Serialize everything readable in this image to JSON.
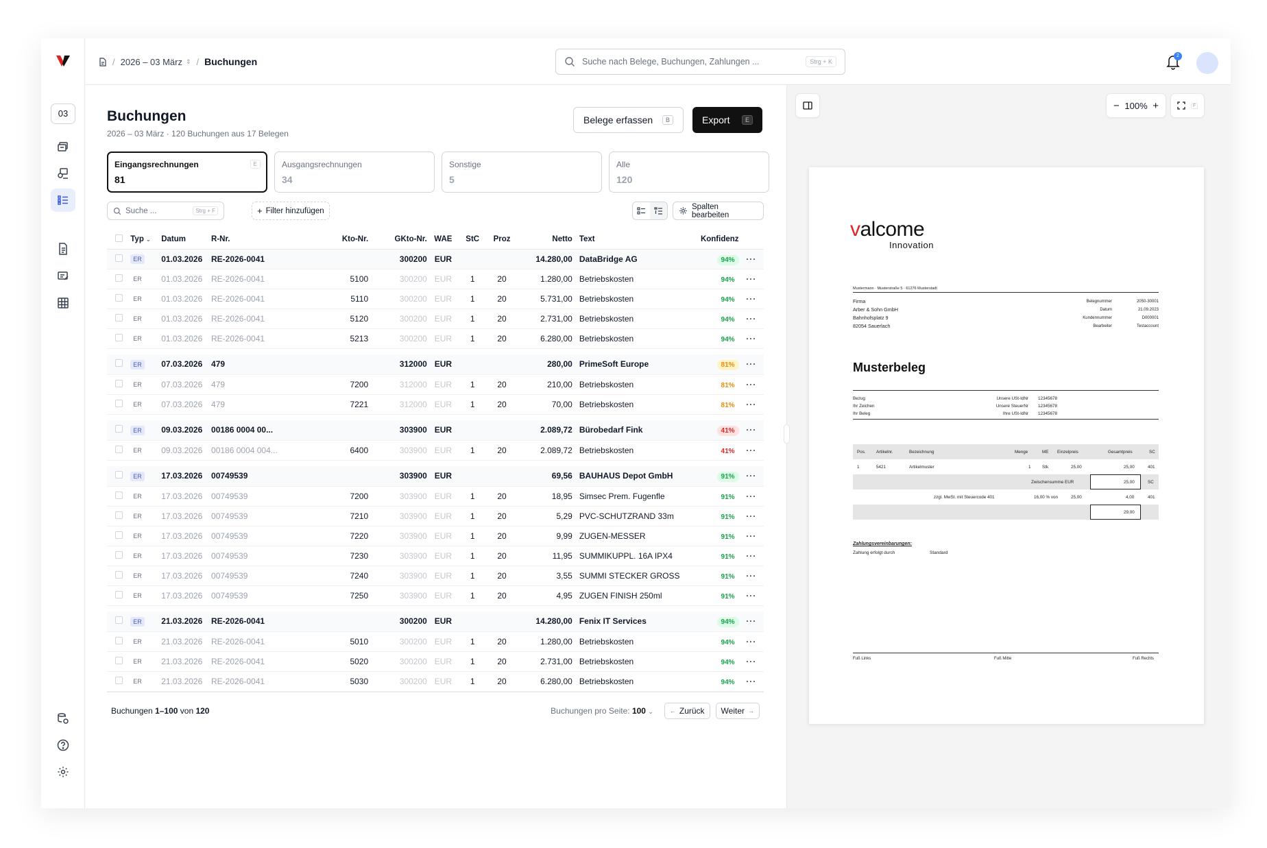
{
  "app": {
    "badge": "03"
  },
  "breadcrumb": {
    "year": "2026 – 03 März",
    "current": "Buchungen"
  },
  "search": {
    "placeholder": "Suche nach Belege, Buchungen, Zahlungen ...",
    "shortcut": "Strg + K"
  },
  "notifications": {
    "count": "2"
  },
  "page": {
    "title": "Buchungen",
    "subtitle": "2026 – 03 März · 120 Buchungen aus 17 Belegen",
    "capture_label": "Belege erfassen",
    "capture_key": "B",
    "export_label": "Export",
    "export_key": "E"
  },
  "tabs": [
    {
      "label": "Eingangsrechnungen",
      "count": "81",
      "key": "E"
    },
    {
      "label": "Ausgangsrechnungen",
      "count": "34"
    },
    {
      "label": "Sonstige",
      "count": "5"
    },
    {
      "label": "Alle",
      "count": "120"
    }
  ],
  "toolbar": {
    "search_placeholder": "Suche ...",
    "search_key": "Strg + F",
    "filter_label": "Filter hinzufügen",
    "columns_label": "Spalten bearbeiten"
  },
  "columns": {
    "typ": "Typ",
    "datum": "Datum",
    "rnr": "R-Nr.",
    "kto": "Kto-Nr.",
    "gkto": "GKto-Nr.",
    "wae": "WAE",
    "stc": "StC",
    "proz": "Proz",
    "netto": "Netto",
    "text": "Text",
    "konfidenz": "Konfidenz"
  },
  "rows": [
    {
      "g": 1,
      "typ": "ER",
      "datum": "01.03.2026",
      "rnr": "RE-2026-0041",
      "kto": "",
      "gkto": "300200",
      "wae": "EUR",
      "stc": "",
      "proz": "",
      "netto": "14.280,00",
      "text": "DataBridge AG",
      "konf": "94%",
      "c": "g"
    },
    {
      "typ": "ER",
      "datum": "01.03.2026",
      "rnr": "RE-2026-0041",
      "kto": "5100",
      "gkto": "300200",
      "wae": "EUR",
      "stc": "1",
      "proz": "20",
      "netto": "1.280,00",
      "text": "Betriebskosten",
      "konf": "94%",
      "c": "g"
    },
    {
      "typ": "ER",
      "datum": "01.03.2026",
      "rnr": "RE-2026-0041",
      "kto": "5110",
      "gkto": "300200",
      "wae": "EUR",
      "stc": "1",
      "proz": "20",
      "netto": "5.731,00",
      "text": "Betriebskosten",
      "konf": "94%",
      "c": "g"
    },
    {
      "typ": "ER",
      "datum": "01.03.2026",
      "rnr": "RE-2026-0041",
      "kto": "5120",
      "gkto": "300200",
      "wae": "EUR",
      "stc": "1",
      "proz": "20",
      "netto": "2.731,00",
      "text": "Betriebskosten",
      "konf": "94%",
      "c": "g"
    },
    {
      "typ": "ER",
      "datum": "01.03.2026",
      "rnr": "RE-2026-0041",
      "kto": "5213",
      "gkto": "300200",
      "wae": "EUR",
      "stc": "1",
      "proz": "20",
      "netto": "6.280,00",
      "text": "Betriebskosten",
      "konf": "94%",
      "c": "g"
    },
    {
      "g": 1,
      "typ": "ER",
      "datum": "07.03.2026",
      "rnr": "479",
      "kto": "",
      "gkto": "312000",
      "wae": "EUR",
      "stc": "",
      "proz": "",
      "netto": "280,00",
      "text": "PrimeSoft Europe",
      "konf": "81%",
      "c": "o"
    },
    {
      "typ": "ER",
      "datum": "07.03.2026",
      "rnr": "479",
      "kto": "7200",
      "gkto": "312000",
      "wae": "EUR",
      "stc": "1",
      "proz": "20",
      "netto": "210,00",
      "text": "Betriebskosten",
      "konf": "81%",
      "c": "o"
    },
    {
      "typ": "ER",
      "datum": "07.03.2026",
      "rnr": "479",
      "kto": "7221",
      "gkto": "312000",
      "wae": "EUR",
      "stc": "1",
      "proz": "20",
      "netto": "70,00",
      "text": "Betriebskosten",
      "konf": "81%",
      "c": "o"
    },
    {
      "g": 1,
      "typ": "ER",
      "datum": "09.03.2026",
      "rnr": "00186 0004 00...",
      "kto": "",
      "gkto": "303900",
      "wae": "EUR",
      "stc": "",
      "proz": "",
      "netto": "2.089,72",
      "text": "Bürobedarf Fink",
      "konf": "41%",
      "c": "rd"
    },
    {
      "typ": "ER",
      "datum": "09.03.2026",
      "rnr": "00186 0004 004...",
      "kto": "6400",
      "gkto": "303900",
      "wae": "EUR",
      "stc": "1",
      "proz": "20",
      "netto": "2.089,72",
      "text": "Betriebskosten",
      "konf": "41%",
      "c": "rd"
    },
    {
      "g": 1,
      "typ": "ER",
      "datum": "17.03.2026",
      "rnr": "00749539",
      "kto": "",
      "gkto": "303900",
      "wae": "EUR",
      "stc": "",
      "proz": "",
      "netto": "69,56",
      "text": "BAUHAUS Depot GmbH",
      "konf": "91%",
      "c": "g"
    },
    {
      "typ": "ER",
      "datum": "17.03.2026",
      "rnr": "00749539",
      "kto": "7200",
      "gkto": "303900",
      "wae": "EUR",
      "stc": "1",
      "proz": "20",
      "netto": "18,95",
      "text": "Simsec Prem. Fugenfle",
      "konf": "91%",
      "c": "g"
    },
    {
      "typ": "ER",
      "datum": "17.03.2026",
      "rnr": "00749539",
      "kto": "7210",
      "gkto": "303900",
      "wae": "EUR",
      "stc": "1",
      "proz": "20",
      "netto": "5,29",
      "text": "PVC-SCHUTZRAND 33m",
      "konf": "91%",
      "c": "g"
    },
    {
      "typ": "ER",
      "datum": "17.03.2026",
      "rnr": "00749539",
      "kto": "7220",
      "gkto": "303900",
      "wae": "EUR",
      "stc": "1",
      "proz": "20",
      "netto": "9,99",
      "text": "ZUGEN-MESSER",
      "konf": "91%",
      "c": "g"
    },
    {
      "typ": "ER",
      "datum": "17.03.2026",
      "rnr": "00749539",
      "kto": "7230",
      "gkto": "303900",
      "wae": "EUR",
      "stc": "1",
      "proz": "20",
      "netto": "11,95",
      "text": "SUMMIKUPPL. 16A IPX4",
      "konf": "91%",
      "c": "g"
    },
    {
      "typ": "ER",
      "datum": "17.03.2026",
      "rnr": "00749539",
      "kto": "7240",
      "gkto": "303900",
      "wae": "EUR",
      "stc": "1",
      "proz": "20",
      "netto": "3,55",
      "text": "SUMMI STECKER GROSS",
      "konf": "91%",
      "c": "g"
    },
    {
      "typ": "ER",
      "datum": "17.03.2026",
      "rnr": "00749539",
      "kto": "7250",
      "gkto": "303900",
      "wae": "EUR",
      "stc": "1",
      "proz": "20",
      "netto": "4,95",
      "text": "ZUGEN FINISH 250ml",
      "konf": "91%",
      "c": "g"
    },
    {
      "g": 1,
      "typ": "ER",
      "datum": "21.03.2026",
      "rnr": "RE-2026-0041",
      "kto": "",
      "gkto": "300200",
      "wae": "EUR",
      "stc": "",
      "proz": "",
      "netto": "14.280,00",
      "text": "Fenix IT Services",
      "konf": "94%",
      "c": "g"
    },
    {
      "typ": "ER",
      "datum": "21.03.2026",
      "rnr": "RE-2026-0041",
      "kto": "5010",
      "gkto": "300200",
      "wae": "EUR",
      "stc": "1",
      "proz": "20",
      "netto": "1.280,00",
      "text": "Betriebskosten",
      "konf": "94%",
      "c": "g"
    },
    {
      "typ": "ER",
      "datum": "21.03.2026",
      "rnr": "RE-2026-0041",
      "kto": "5020",
      "gkto": "300200",
      "wae": "EUR",
      "stc": "1",
      "proz": "20",
      "netto": "2.731,00",
      "text": "Betriebskosten",
      "konf": "94%",
      "c": "g"
    },
    {
      "typ": "ER",
      "datum": "21.03.2026",
      "rnr": "RE-2026-0041",
      "kto": "5030",
      "gkto": "300200",
      "wae": "EUR",
      "stc": "1",
      "proz": "20",
      "netto": "6.280,00",
      "text": "Betriebskosten",
      "konf": "94%",
      "c": "g"
    }
  ],
  "pagination": {
    "prefix": "Buchungen ",
    "range": "1–100",
    "of": " von ",
    "total": "120",
    "per_page_label": "Buchungen pro Seite:",
    "per_page": "100",
    "prev": "Zurück",
    "next": "Weiter"
  },
  "viewer": {
    "zoom": "100%",
    "fullscreen_key": "F"
  },
  "doc": {
    "brand_v": "v",
    "brand_rest": "alcome",
    "brand_sub": "Innovation",
    "sender": "Mustermann · Musterstraße 5 · 61276 Musterstadt",
    "address": [
      "Firma",
      "Arber & Sohn GmbH",
      "Bahnhofsplatz 9",
      "82054 Sauerlach"
    ],
    "meta": [
      [
        "Belegnummer",
        "2050-30001"
      ],
      [
        "Datum",
        "21.09.2023"
      ],
      [
        "Kundennummer",
        "D000001"
      ],
      [
        "Bearbeiter",
        "Testaccount"
      ]
    ],
    "title": "Musterbeleg",
    "ref_left": [
      "Bezug",
      "Ihr Zeichen",
      "Ihr Beleg"
    ],
    "ref_right": [
      [
        "Unsere USt-IdNr",
        "12345678"
      ],
      [
        "Unsere SteuerNr",
        "12345678"
      ],
      [
        "Ihre USt-IdNr",
        "12345678"
      ]
    ],
    "table_head": [
      "Pos.",
      "Artikelnr.",
      "Bezeichnung",
      "Menge",
      "ME",
      "Einzelpreis",
      "Gesamtpreis",
      "SC"
    ],
    "table_row": [
      "1",
      "5421",
      "Artikelmuster",
      "1",
      "Stk",
      "25,00",
      "25,00",
      "401"
    ],
    "subtotal_label": "Zwischensumme  EUR",
    "subtotal": "25,00",
    "subtotal_sc": "SC",
    "tax_label": "zzgl. MwSt. mit Steuercode 401",
    "tax_rate": "16,00 % von",
    "tax_base": "25,00",
    "tax": "4,00",
    "tax_sc": "401",
    "total": "29,00",
    "payment_title": "Zahlungsvereinbarungen:",
    "payment_label": "Zahlung erfolgt durch",
    "payment_value": "Standard",
    "footer": [
      "Fuß Links",
      "Fuß Mitte",
      "Fuß Rechts"
    ]
  }
}
